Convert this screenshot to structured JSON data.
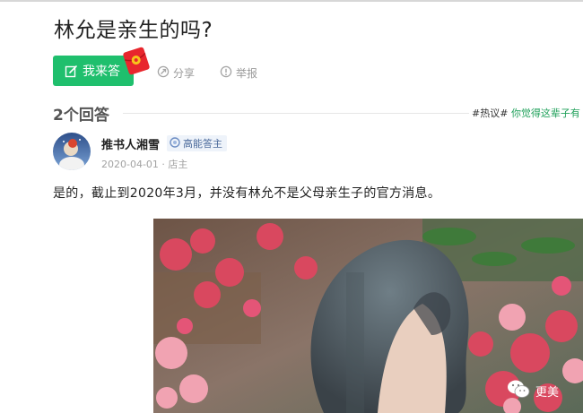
{
  "question": {
    "title": "林允是亲生的吗?"
  },
  "actions": {
    "answer_label": "我来答",
    "share_label": "分享",
    "report_label": "举报"
  },
  "answers": {
    "count_label": "2个回答",
    "hashtag": {
      "tag": "#热议#",
      "topic": "你觉得这辈子有"
    }
  },
  "answer": {
    "author": "推书人湘雪",
    "badge": "高能答主",
    "meta": "2020-04-01 · 店主",
    "text": "是的，截止到2020年3月，并没有林允不是父母亲生子的官方消息。"
  },
  "watermark": {
    "text": "更美"
  },
  "colors": {
    "accent": "#1fbf6d",
    "topic": "#1fa05a",
    "badge_text": "#4b6a9b"
  },
  "icons": [
    "edit-icon",
    "red-envelope-icon",
    "share-icon",
    "report-icon",
    "medal-icon",
    "wechat-icon"
  ]
}
